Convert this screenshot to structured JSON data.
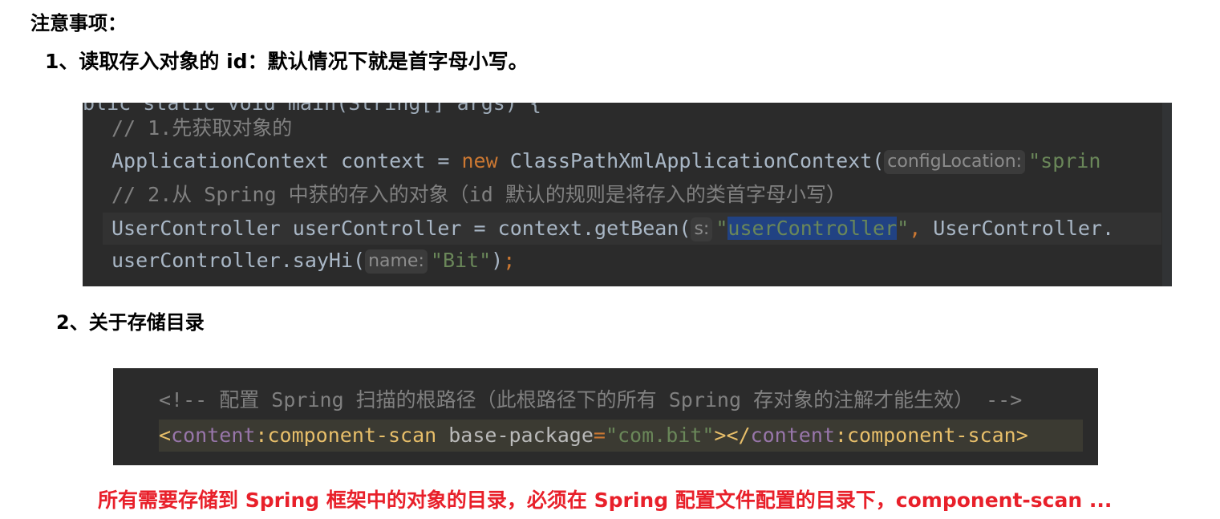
{
  "heading": "注意事项：",
  "point1": "1、读取存入对象的 id：默认情况下就是首字母小写。",
  "point2": "2、关于存储目录",
  "code1": {
    "line0": "blic static void main(String[] args) {",
    "line1": "// 1.先获取对象的",
    "line2_a": "ApplicationContext context = ",
    "line2_kw": "new",
    "line2_b": " ClassPathXmlApplicationContext(",
    "line2_hint": "configLocation:",
    "line2_str": "\"sprin",
    "line3": "// 2.从 Spring 中获的存入的对象（id 默认的规则是将存入的类首字母小写）",
    "line4_a": "UserController userController = context.getBean(",
    "line4_hint": "s:",
    "line4_q1": "\"",
    "line4_sel": "userController",
    "line4_q2": "\"",
    "line4_comma": ",",
    "line4_b": " UserController.",
    "line5_a": "userController.sayHi(",
    "line5_hint": "name:",
    "line5_str": "\"Bit\"",
    "line5_b": ")",
    "line5_semi": ";"
  },
  "code2": {
    "comment": "<!-- 配置 Spring 扫描的根路径（此根路径下的所有 Spring 存对象的注解才能生效） -->",
    "lt": "<",
    "ns1": "content",
    "tag1": ":component-scan",
    "attr": " base-package",
    "eq": "=",
    "val": "\"com.bit\"",
    "close1": "></",
    "ns2": "content",
    "tag2": ":component-scan",
    "gt": ">"
  },
  "note": "所有需要存储到 Spring 框架中的对象的目录，必须在 Spring 配置文件配置的目录下，component-scan ...",
  "colors": {
    "note": "#e8202a",
    "code_bg": "#2b2b2b",
    "keyword": "#cc7832",
    "string": "#6a8759",
    "comment": "#808080",
    "selection": "#214283"
  }
}
